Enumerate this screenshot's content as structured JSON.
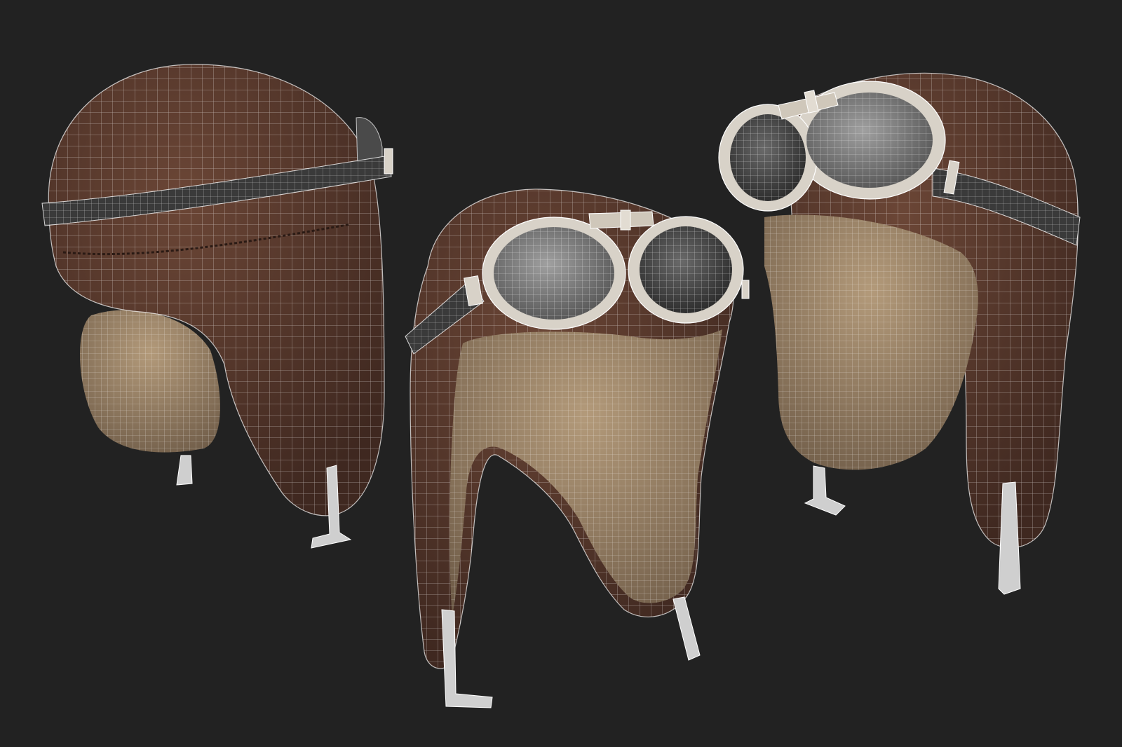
{
  "palette": {
    "background": "#222222",
    "leather": "#5a3a2d",
    "leather_dark": "#3f2820",
    "fleece": "#9a8266",
    "fleece_dark": "#6f5c48",
    "strap": "#3a3a3a",
    "lens": "#8c8c8c",
    "lens_dark": "#4a4a4a",
    "rim": "#d8d2c8",
    "wire": "#ffffff"
  },
  "models": [
    {
      "name": "aviator-helmet-back-view"
    },
    {
      "name": "aviator-helmet-front-view"
    },
    {
      "name": "aviator-helmet-three-quarter-view"
    }
  ]
}
